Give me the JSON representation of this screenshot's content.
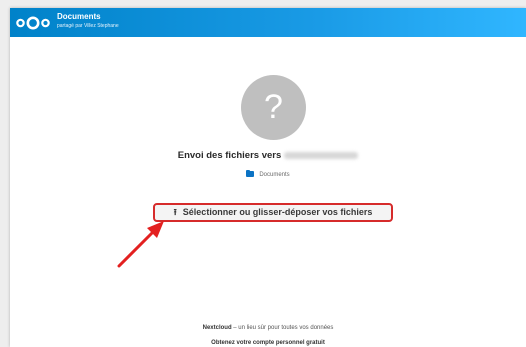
{
  "header": {
    "title": "Documents",
    "subtitle": "partagé par Villez Stephane",
    "logo_icon": "nextcloud-logo-icon"
  },
  "main": {
    "avatar_symbol": "?",
    "upload_heading": "Envoi des fichiers vers",
    "folder_icon": "folder-icon",
    "folder_name": "Documents",
    "upload_button_label": "Sélectionner ou glisser-déposer vos fichiers",
    "upload_icon": "upload-icon"
  },
  "footer": {
    "brand": "Nextcloud",
    "tagline": " – un lieu sûr pour toutes vos données",
    "signup_text": "Obtenez votre compte personnel gratuit"
  },
  "annotation": {
    "arrow_color": "#e32020",
    "highlight_color": "#d62b2b"
  },
  "colors": {
    "header_start": "#0082c9",
    "header_end": "#30b6ff",
    "folder": "#0b73c4"
  }
}
